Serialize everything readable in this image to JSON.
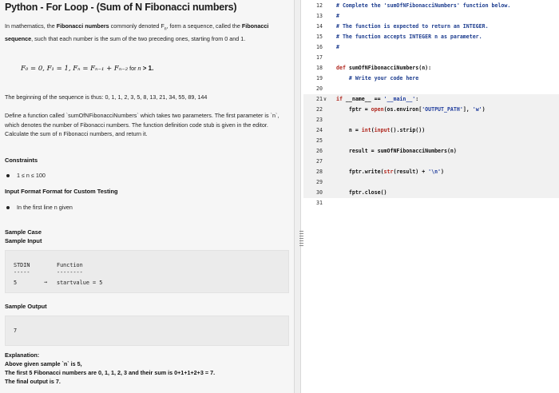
{
  "problem": {
    "title": "Python - For Loop - (Sum of N Fibonacci numbers)",
    "intro": {
      "t1": "In mathematics, the ",
      "b1": "Fibonacci numbers",
      "t2": " commonly denoted F",
      "sub": "n",
      "t3": ", form a sequence, called the ",
      "b2": "Fibonacci sequence",
      "t4": ", such that each number is the sum of the two preceding ones, starting from 0 and 1."
    },
    "formula": {
      "f0": "F₀ = 0, F₁ = 1,  Fₙ = Fₙ₋₁ + Fₙ₋₂",
      "for_text": " for ",
      "cond_n": "n",
      "cond_rest": " > 1."
    },
    "sequence_text": "The beginning of the sequence is thus: 0, 1, 1, 2, 3, 5, 8, 13, 21, 34, 55, 89, 144",
    "define_text": "Define a function called `sumOfNFibonacciNumbers` which takes two parameters. The first parameter is `n`, which denotes the number of Fibonacci numbers. The function definition code stub is given in the editor. Calculate the sum of n Fibonacci numbers, and return it.",
    "constraints_heading": "Constraints",
    "constraint_1": "1 ≤ n ≤ 100",
    "input_format_heading": "Input Format Format for Custom Testing",
    "input_format_item": "In the first line n given",
    "sample_case_heading": "Sample Case",
    "sample_input_heading": "Sample Input",
    "sample_table": {
      "col1_header": "STDIN",
      "col1_rule": "-----",
      "col2_header": "Function",
      "col2_rule": "--------",
      "stdin_value": "5",
      "arrow": "→",
      "function_value": "startvalue = 5"
    },
    "sample_output_heading": "Sample Output",
    "sample_output_value": "7",
    "explanation_heading": "Explanation:",
    "explanation_line_1": "Above given sample `n` is 5,",
    "explanation_line_2": "The first 5 Fibonacci numbers are 0, 1, 1, 2, 3 and their sum is 0+1+1+2+3 = 7.",
    "explanation_line_3": "The final output is 7."
  },
  "editor": {
    "fold_arrow": "∨",
    "lines": [
      {
        "no": "12",
        "parts": [
          {
            "t": "# Complete the 'sumOfNFibonacciNumbers' function below.",
            "c": "c-comment"
          }
        ]
      },
      {
        "no": "13",
        "parts": [
          {
            "t": "#",
            "c": "c-comment"
          }
        ]
      },
      {
        "no": "14",
        "parts": [
          {
            "t": "# The function is expected to return an INTEGER.",
            "c": "c-comment"
          }
        ]
      },
      {
        "no": "15",
        "parts": [
          {
            "t": "# The function accepts INTEGER n as parameter.",
            "c": "c-comment"
          }
        ]
      },
      {
        "no": "16",
        "parts": [
          {
            "t": "#",
            "c": "c-comment"
          }
        ]
      },
      {
        "no": "17",
        "parts": []
      },
      {
        "no": "18",
        "parts": [
          {
            "t": "def ",
            "c": "c-kw"
          },
          {
            "t": "sumOfNFibonacciNumbers(n):",
            "c": "c-def"
          }
        ]
      },
      {
        "no": "19",
        "parts": [
          {
            "t": "    # Write your code here",
            "c": "c-comment"
          }
        ]
      },
      {
        "no": "20",
        "parts": []
      },
      {
        "no": "21",
        "parts": [
          {
            "t": "if ",
            "c": "c-kw"
          },
          {
            "t": "__name__ == ",
            "c": "c-def"
          },
          {
            "t": "'__main__'",
            "c": "c-str"
          },
          {
            "t": ":",
            "c": "c-def"
          }
        ]
      },
      {
        "no": "22",
        "parts": [
          {
            "t": "    fptr = ",
            "c": "c-def"
          },
          {
            "t": "open",
            "c": "c-fn"
          },
          {
            "t": "(os.environ[",
            "c": "c-def"
          },
          {
            "t": "'OUTPUT_PATH'",
            "c": "c-str"
          },
          {
            "t": "], ",
            "c": "c-def"
          },
          {
            "t": "'w'",
            "c": "c-str"
          },
          {
            "t": ")",
            "c": "c-def"
          }
        ]
      },
      {
        "no": "23",
        "parts": []
      },
      {
        "no": "24",
        "parts": [
          {
            "t": "    n = ",
            "c": "c-def"
          },
          {
            "t": "int",
            "c": "c-fn"
          },
          {
            "t": "(",
            "c": "c-def"
          },
          {
            "t": "input",
            "c": "c-fn"
          },
          {
            "t": "().strip())",
            "c": "c-def"
          }
        ]
      },
      {
        "no": "25",
        "parts": []
      },
      {
        "no": "26",
        "parts": [
          {
            "t": "    result = sumOfNFibonacciNumbers(n)",
            "c": "c-def"
          }
        ]
      },
      {
        "no": "27",
        "parts": []
      },
      {
        "no": "28",
        "parts": [
          {
            "t": "    fptr.write(",
            "c": "c-def"
          },
          {
            "t": "str",
            "c": "c-fn"
          },
          {
            "t": "(result) + ",
            "c": "c-def"
          },
          {
            "t": "'\\n'",
            "c": "c-str"
          },
          {
            "t": ")",
            "c": "c-def"
          }
        ]
      },
      {
        "no": "29",
        "parts": []
      },
      {
        "no": "30",
        "parts": [
          {
            "t": "    fptr.close()",
            "c": "c-def"
          }
        ]
      },
      {
        "no": "31",
        "parts": []
      }
    ]
  }
}
